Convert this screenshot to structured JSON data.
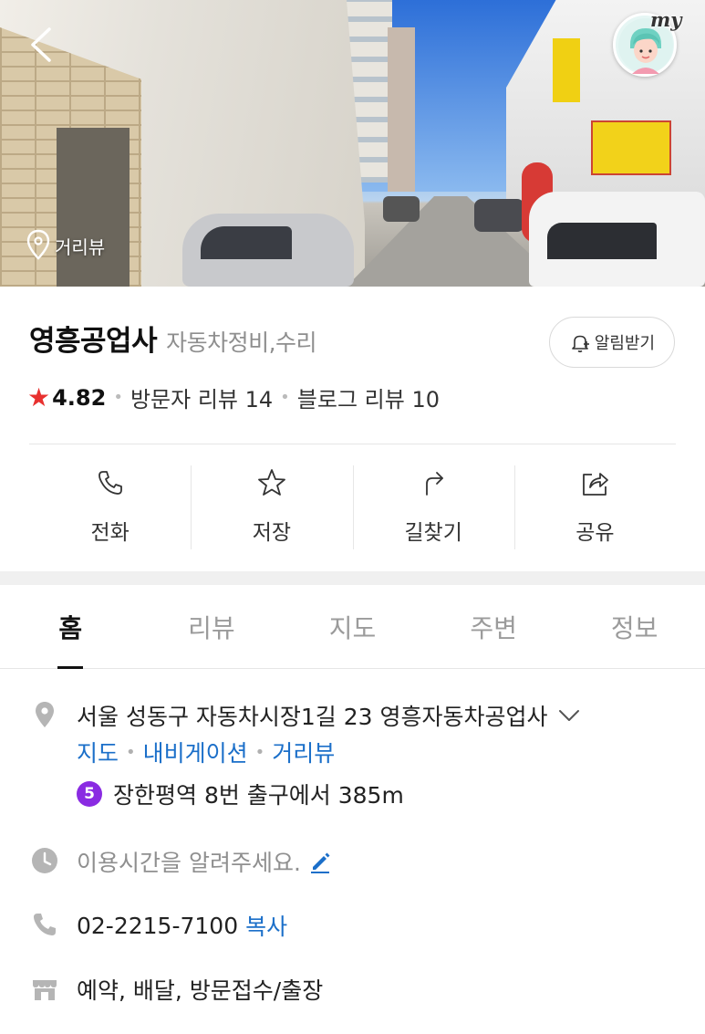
{
  "header": {
    "back_icon": "chevron-left-icon",
    "my_label": "my",
    "streetview_tag": "거리뷰"
  },
  "place": {
    "name": "영흥공업사",
    "category": "자동차정비,수리",
    "alarm_button": "알림받기",
    "rating": "4.82",
    "visitor_reviews": "방문자 리뷰 14",
    "blog_reviews": "블로그 리뷰 10"
  },
  "actions": [
    {
      "label": "전화",
      "icon": "phone-icon"
    },
    {
      "label": "저장",
      "icon": "star-icon"
    },
    {
      "label": "길찾기",
      "icon": "directions-icon"
    },
    {
      "label": "공유",
      "icon": "share-icon"
    }
  ],
  "tabs": [
    {
      "label": "홈",
      "active": true
    },
    {
      "label": "리뷰",
      "active": false
    },
    {
      "label": "지도",
      "active": false
    },
    {
      "label": "주변",
      "active": false
    },
    {
      "label": "정보",
      "active": false
    }
  ],
  "details": {
    "address": "서울 성동구 자동차시장1길 23 영흥자동차공업사",
    "links": [
      "지도",
      "내비게이션",
      "거리뷰"
    ],
    "subway_line": "5",
    "subway_text": "장한평역 8번 출구에서 385m",
    "hours_prompt": "이용시간을 알려주세요.",
    "phone": "02-2215-7100",
    "copy_label": "복사",
    "services": "예약, 배달, 방문접수/출장"
  },
  "colors": {
    "link_blue": "#1b6fc9",
    "star_red": "#e8312f",
    "subway_line5": "#8a2be2",
    "icon_gray": "#b5b5b5"
  }
}
